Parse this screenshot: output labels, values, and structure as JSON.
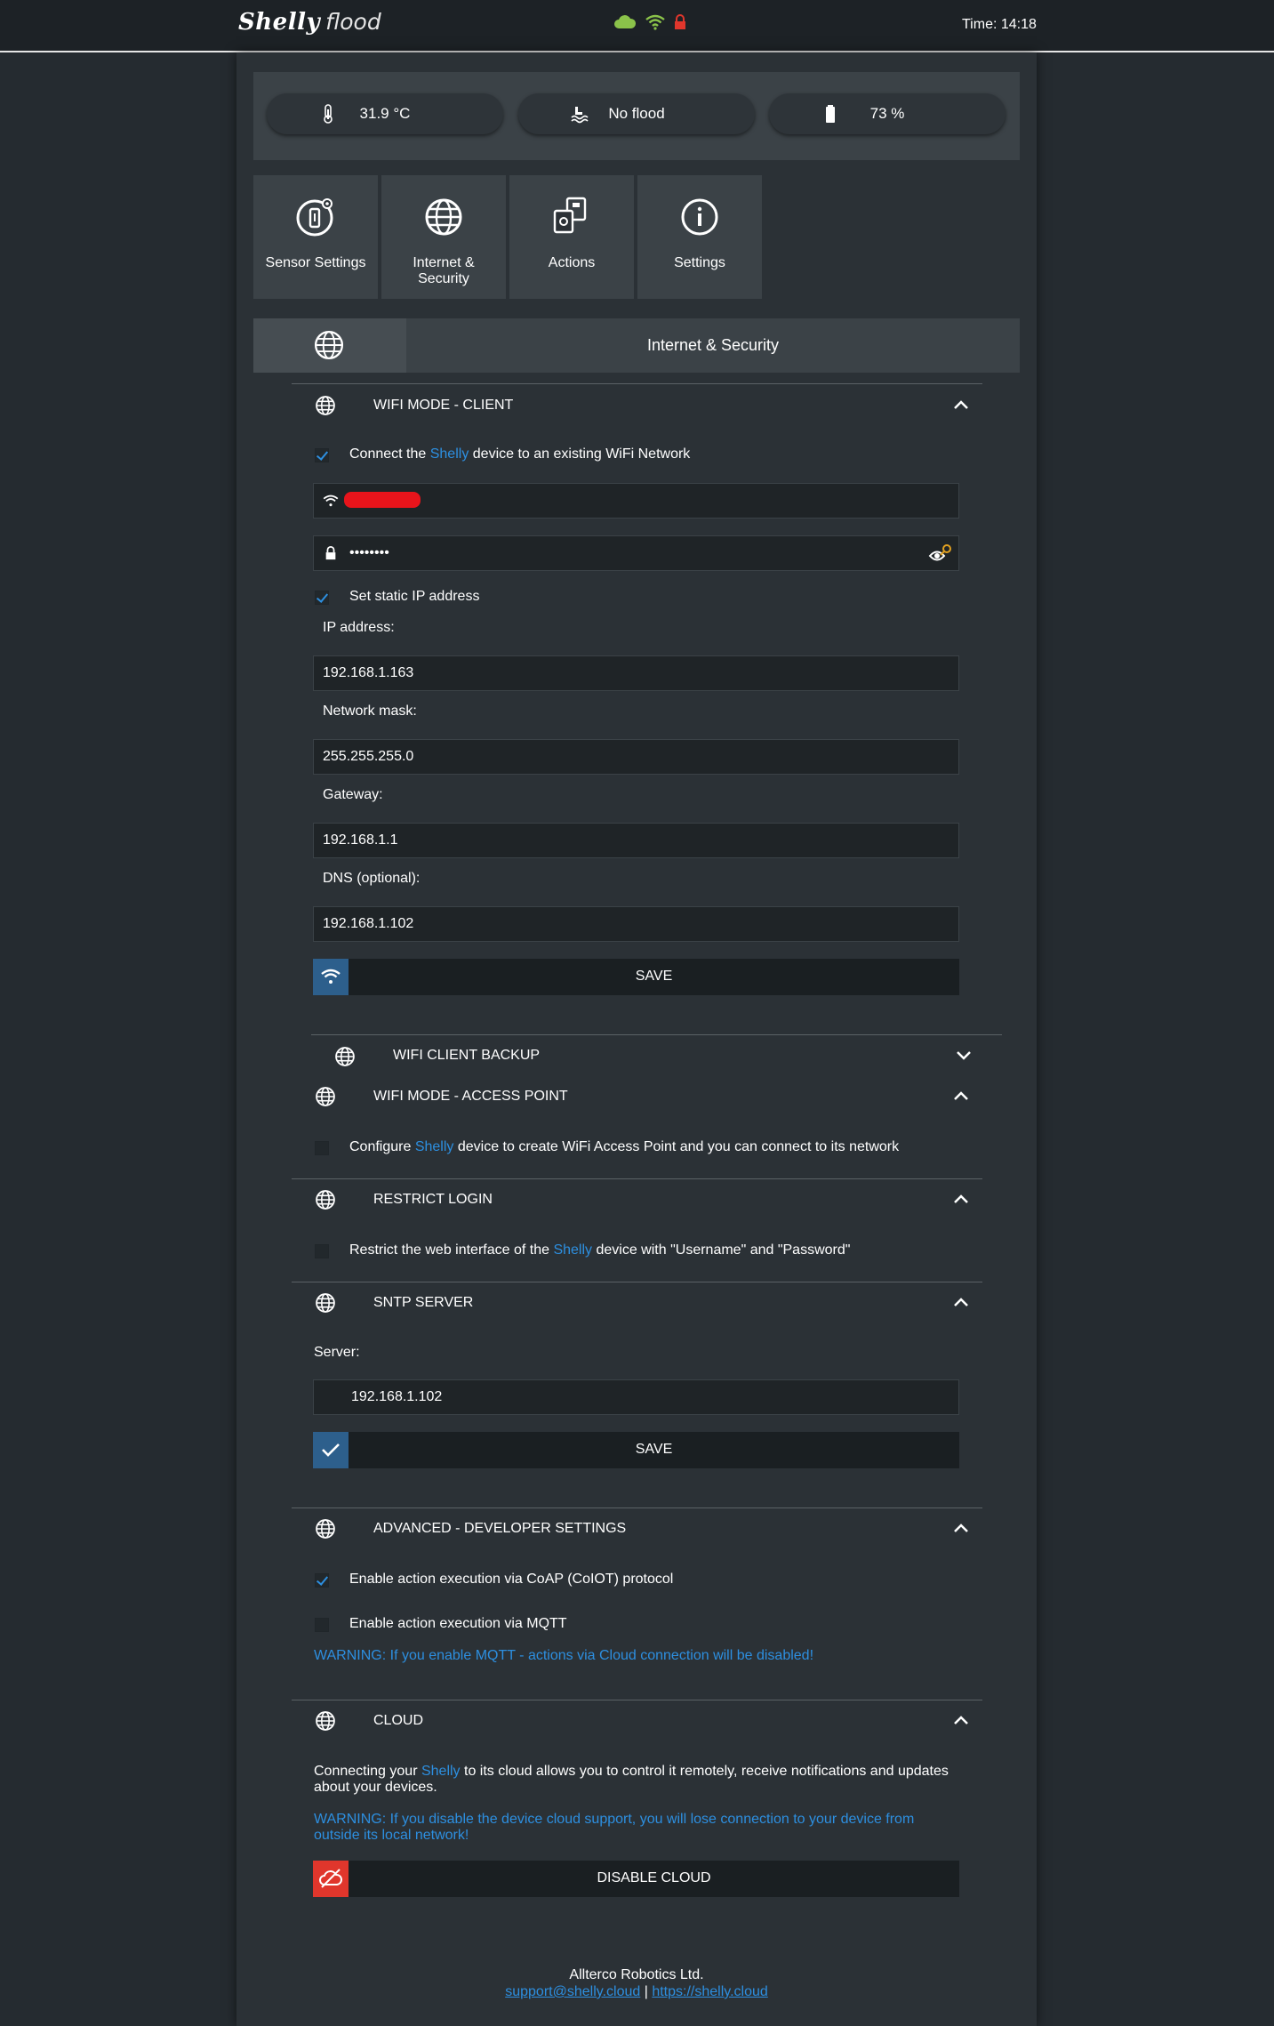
{
  "header": {
    "logo_brand": "Shelly",
    "logo_product": "flood",
    "time": "Time: 14:18"
  },
  "sensors": {
    "temperature": "31.9 °C",
    "flood": "No flood",
    "battery": "73 %"
  },
  "tiles": [
    {
      "label": "Sensor Settings"
    },
    {
      "label": "Internet & Security"
    },
    {
      "label": "Actions"
    },
    {
      "label": "Settings"
    }
  ],
  "page_title": "Internet & Security",
  "wifi_client": {
    "title": "WIFI MODE - CLIENT",
    "connect_pre": "Connect the",
    "brand": "Shelly",
    "connect_post": "device to an existing WiFi Network",
    "connect_checked": true,
    "ssid_value": "",
    "password_value": "••••••••",
    "static_ip_label": "Set static IP address",
    "static_ip_checked": true,
    "ip_label": "IP address:",
    "ip_value": "192.168.1.163",
    "mask_label": "Network mask:",
    "mask_value": "255.255.255.0",
    "gateway_label": "Gateway:",
    "gateway_value": "192.168.1.1",
    "dns_label": "DNS (optional):",
    "dns_value": "192.168.1.102",
    "save_label": "SAVE"
  },
  "wifi_backup": {
    "title": "WIFI CLIENT BACKUP"
  },
  "wifi_ap": {
    "title": "WIFI MODE - ACCESS POINT",
    "text_pre": "Configure",
    "brand": "Shelly",
    "text_post": "device to create WiFi Access Point and you can connect to its network",
    "checked": false
  },
  "restrict_login": {
    "title": "RESTRICT LOGIN",
    "text_pre": "Restrict the web interface of the",
    "brand": "Shelly",
    "text_post": "device with \"Username\" and \"Password\"",
    "checked": false
  },
  "sntp": {
    "title": "SNTP SERVER",
    "server_label": "Server:",
    "server_value": "192.168.1.102",
    "save_label": "SAVE"
  },
  "advanced": {
    "title": "ADVANCED - DEVELOPER SETTINGS",
    "coap_label": "Enable action execution via CoAP (CoIOT) protocol",
    "coap_checked": true,
    "mqtt_label": "Enable action execution via MQTT",
    "mqtt_checked": false,
    "warning": "WARNING: If you enable MQTT - actions via Cloud connection will be disabled!"
  },
  "cloud": {
    "title": "CLOUD",
    "text_pre": "Connecting your",
    "brand": "Shelly",
    "text_post": "to its cloud allows you to control it remotely, receive notifications and updates about your devices.",
    "warning": "WARNING: If you disable the device cloud support, you will lose connection to your device from outside its local network!",
    "button_label": "DISABLE CLOUD"
  },
  "footer": {
    "company": "Allterco Robotics Ltd.",
    "email": "support@shelly.cloud",
    "separator": "|",
    "website": "https://shelly.cloud"
  },
  "colors": {
    "accent_blue": "#2d8fe0",
    "cloud_green": "#8bc34a",
    "lock_red": "#e0362c"
  }
}
